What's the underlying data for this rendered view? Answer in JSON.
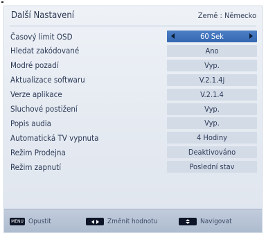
{
  "header": {
    "title": "Další Nastavení",
    "country": "Země : Německo"
  },
  "settings": [
    {
      "label": "Časový limit OSD",
      "value": "60 Sek",
      "selected": true
    },
    {
      "label": "Hledat zakódované",
      "value": "Ano"
    },
    {
      "label": "Modré pozadí",
      "value": "Vyp."
    },
    {
      "label": "Aktualizace softwaru",
      "value": "V.2.1.4j"
    },
    {
      "label": "Verze aplikace",
      "value": "V.2.1.4"
    },
    {
      "label": "Sluchové postižení",
      "value": "Vyp."
    },
    {
      "label": "Popis audia",
      "value": "Vyp."
    },
    {
      "label": "Automatická TV vypnuta",
      "value": "4 Hodiny"
    },
    {
      "label": "Režim Prodejna",
      "value": "Deaktivováno"
    },
    {
      "label": "Režim zapnutí",
      "value": "Poslední stav"
    }
  ],
  "footer": {
    "exit_key": "MENU",
    "exit_label": "Opustit",
    "change_label": "Změnit hodnotu",
    "navigate_label": "Navigovat"
  },
  "colors": {
    "selected_value_bg": "#3f72bb",
    "value_bg": "#d3dbe7",
    "panel_bg": "#e6ebf2",
    "footer_bg": "#b7c4d6"
  },
  "icons": [
    "menu-key-icon",
    "left-right-keys-icon",
    "up-down-keys-icon",
    "left-arrow-icon",
    "right-arrow-icon"
  ]
}
